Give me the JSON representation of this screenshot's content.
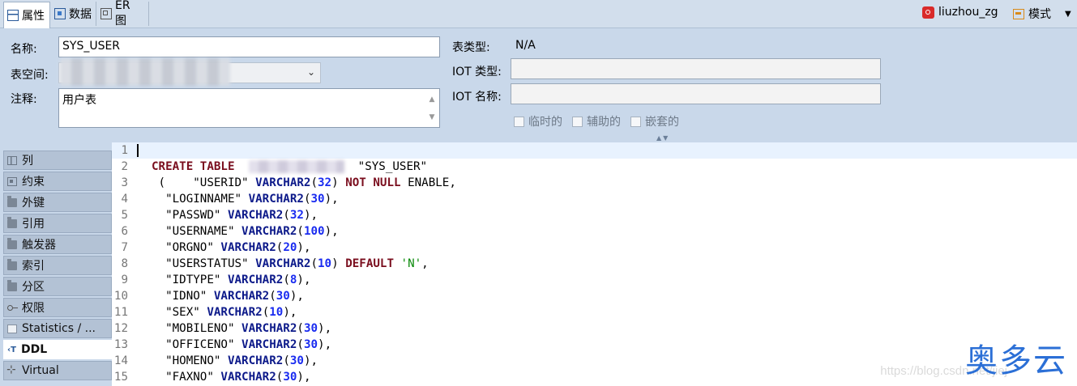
{
  "tabs": [
    {
      "label": "属性",
      "icon": "properties-icon",
      "active": true
    },
    {
      "label": "数据",
      "icon": "data-grid-icon",
      "active": false
    },
    {
      "label": "ER 图",
      "icon": "er-diagram-icon",
      "active": false
    }
  ],
  "connection": {
    "label": "liuzhou_zg",
    "icon": "connection-icon"
  },
  "schema_menu": {
    "label": "模式",
    "icon": "schema-icon",
    "arrow": "▼"
  },
  "form": {
    "name_label": "名称:",
    "name_value": "SYS_USER",
    "tablespace_label": "表空间:",
    "comment_label": "注释:",
    "comment_value": "用户表",
    "table_type_label": "表类型:",
    "table_type_value": "N/A",
    "iot_type_label": "IOT 类型:",
    "iot_name_label": "IOT 名称:",
    "checkboxes": [
      {
        "label": "临时的",
        "checked": false
      },
      {
        "label": "辅助的",
        "checked": false
      },
      {
        "label": "嵌套的",
        "checked": false
      }
    ]
  },
  "nav": [
    {
      "label": "列",
      "icon": "columns-icon",
      "active": false
    },
    {
      "label": "约束",
      "icon": "constraints-icon",
      "active": false
    },
    {
      "label": "外键",
      "icon": "folder-icon",
      "active": false
    },
    {
      "label": "引用",
      "icon": "folder-icon",
      "active": false
    },
    {
      "label": "触发器",
      "icon": "folder-icon",
      "active": false
    },
    {
      "label": "索引",
      "icon": "folder-icon",
      "active": false
    },
    {
      "label": "分区",
      "icon": "folder-icon",
      "active": false
    },
    {
      "label": "权限",
      "icon": "key-icon",
      "active": false
    },
    {
      "label": "Statistics / ...",
      "icon": "statistics-icon",
      "active": false
    },
    {
      "label": "DDL",
      "icon": "ddl-icon",
      "active": true
    },
    {
      "label": "Virtual",
      "icon": "virtual-icon",
      "active": false
    }
  ],
  "ddl_lines": [
    {
      "n": "1",
      "tokens": []
    },
    {
      "n": "2",
      "tokens": [
        [
          "kw",
          "CREATE TABLE"
        ],
        [
          "p",
          "  "
        ],
        [
          "blur",
          ""
        ],
        [
          "p",
          "  \"SYS_USER\""
        ]
      ]
    },
    {
      "n": "3",
      "tokens": [
        [
          "p",
          " (    \"USERID\" "
        ],
        [
          "ty",
          "VARCHAR2"
        ],
        [
          "p",
          "("
        ],
        [
          "num",
          "32"
        ],
        [
          "p",
          ") "
        ],
        [
          "kw",
          "NOT NULL"
        ],
        [
          "p",
          " ENABLE,"
        ]
      ]
    },
    {
      "n": "4",
      "tokens": [
        [
          "p",
          "  \"LOGINNAME\" "
        ],
        [
          "ty",
          "VARCHAR2"
        ],
        [
          "p",
          "("
        ],
        [
          "num",
          "30"
        ],
        [
          "p",
          "),"
        ]
      ]
    },
    {
      "n": "5",
      "tokens": [
        [
          "p",
          "  \"PASSWD\" "
        ],
        [
          "ty",
          "VARCHAR2"
        ],
        [
          "p",
          "("
        ],
        [
          "num",
          "32"
        ],
        [
          "p",
          "),"
        ]
      ]
    },
    {
      "n": "6",
      "tokens": [
        [
          "p",
          "  \"USERNAME\" "
        ],
        [
          "ty",
          "VARCHAR2"
        ],
        [
          "p",
          "("
        ],
        [
          "num",
          "100"
        ],
        [
          "p",
          "),"
        ]
      ]
    },
    {
      "n": "7",
      "tokens": [
        [
          "p",
          "  \"ORGNO\" "
        ],
        [
          "ty",
          "VARCHAR2"
        ],
        [
          "p",
          "("
        ],
        [
          "num",
          "20"
        ],
        [
          "p",
          "),"
        ]
      ]
    },
    {
      "n": "8",
      "tokens": [
        [
          "p",
          "  \"USERSTATUS\" "
        ],
        [
          "ty",
          "VARCHAR2"
        ],
        [
          "p",
          "("
        ],
        [
          "num",
          "10"
        ],
        [
          "p",
          ") "
        ],
        [
          "kw",
          "DEFAULT"
        ],
        [
          "p",
          " "
        ],
        [
          "str",
          "'N'"
        ],
        [
          "p",
          ","
        ]
      ]
    },
    {
      "n": "9",
      "tokens": [
        [
          "p",
          "  \"IDTYPE\" "
        ],
        [
          "ty",
          "VARCHAR2"
        ],
        [
          "p",
          "("
        ],
        [
          "num",
          "8"
        ],
        [
          "p",
          "),"
        ]
      ]
    },
    {
      "n": "10",
      "tokens": [
        [
          "p",
          "  \"IDNO\" "
        ],
        [
          "ty",
          "VARCHAR2"
        ],
        [
          "p",
          "("
        ],
        [
          "num",
          "30"
        ],
        [
          "p",
          "),"
        ]
      ]
    },
    {
      "n": "11",
      "tokens": [
        [
          "p",
          "  \"SEX\" "
        ],
        [
          "ty",
          "VARCHAR2"
        ],
        [
          "p",
          "("
        ],
        [
          "num",
          "10"
        ],
        [
          "p",
          "),"
        ]
      ]
    },
    {
      "n": "12",
      "tokens": [
        [
          "p",
          "  \"MOBILENO\" "
        ],
        [
          "ty",
          "VARCHAR2"
        ],
        [
          "p",
          "("
        ],
        [
          "num",
          "30"
        ],
        [
          "p",
          "),"
        ]
      ]
    },
    {
      "n": "13",
      "tokens": [
        [
          "p",
          "  \"OFFICENO\" "
        ],
        [
          "ty",
          "VARCHAR2"
        ],
        [
          "p",
          "("
        ],
        [
          "num",
          "30"
        ],
        [
          "p",
          "),"
        ]
      ]
    },
    {
      "n": "14",
      "tokens": [
        [
          "p",
          "  \"HOMENO\" "
        ],
        [
          "ty",
          "VARCHAR2"
        ],
        [
          "p",
          "("
        ],
        [
          "num",
          "30"
        ],
        [
          "p",
          "),"
        ]
      ]
    },
    {
      "n": "15",
      "tokens": [
        [
          "p",
          "  \"FAXNO\" "
        ],
        [
          "ty",
          "VARCHAR2"
        ],
        [
          "p",
          "("
        ],
        [
          "num",
          "30"
        ],
        [
          "p",
          "),"
        ]
      ]
    }
  ],
  "watermark": "https://blog.csdn.net/jiej",
  "brand": "奥多云"
}
